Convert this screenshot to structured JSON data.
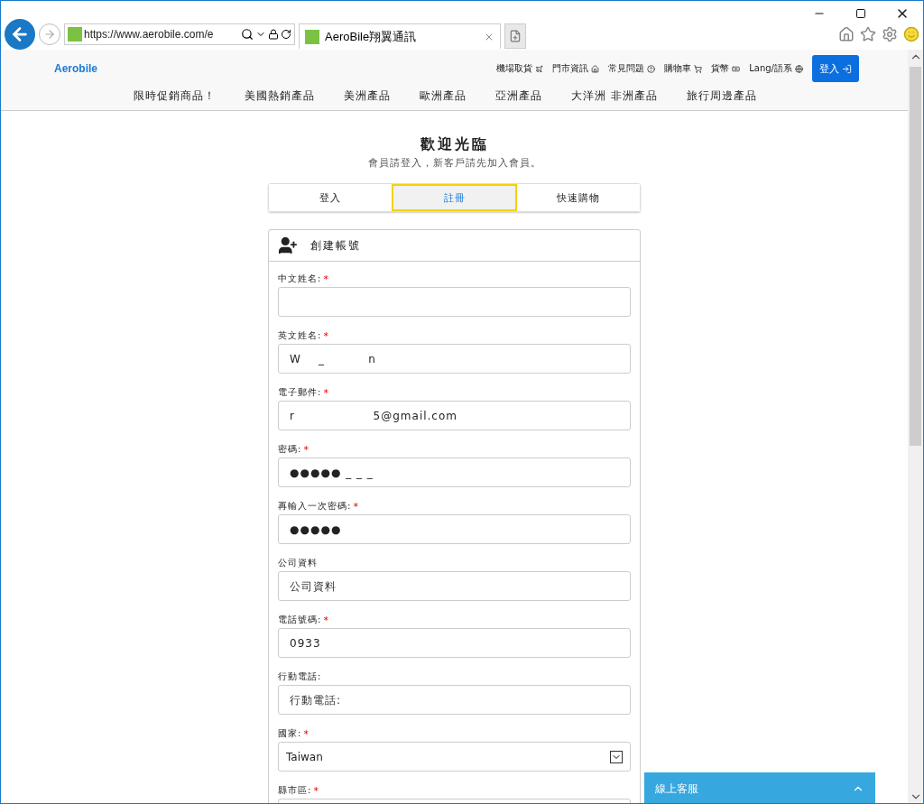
{
  "browser": {
    "url": "https://www.aerobile.com/e",
    "tab_title": "AeroBile翔翼通訊"
  },
  "site": {
    "logo": "Aerobile",
    "top_links": [
      {
        "label": "機場取貨"
      },
      {
        "label": "門市資訊"
      },
      {
        "label": "常見問題"
      },
      {
        "label": "購物車"
      },
      {
        "label": "貨幣"
      },
      {
        "label": "Lang/語系"
      }
    ],
    "login_button": "登入",
    "nav": [
      "限時促銷商品！",
      "美國熱銷產品",
      "美洲產品",
      "歐洲產品",
      "亞洲產品",
      "大洋洲 非洲產品",
      "旅行周邊產品"
    ]
  },
  "heading": {
    "title": "歡迎光臨",
    "subtitle": "會員請登入，新客戶請先加入會員。"
  },
  "tabs": [
    {
      "label": "登入",
      "selected": false
    },
    {
      "label": "註冊",
      "selected": true
    },
    {
      "label": "快速購物",
      "selected": false
    }
  ],
  "form": {
    "title": "創建帳號",
    "fields": [
      {
        "kind": "text",
        "label": "中文姓名:",
        "required_mark": "*"
      },
      {
        "kind": "text",
        "label": "英文姓名:",
        "required_mark": "*",
        "value": "W    _          n"
      },
      {
        "kind": "text",
        "label": "電子郵件:",
        "required_mark": "*",
        "value": "r                  5@gmail.com"
      },
      {
        "kind": "text",
        "label": "密碼:",
        "required_mark": "*",
        "value": "●●●●● _ _ _"
      },
      {
        "kind": "text",
        "label": "再輸入一次密碼:",
        "required_mark": "*",
        "value": "●●●●●"
      },
      {
        "kind": "text",
        "label": "公司資料",
        "placeholder": "公司資料"
      },
      {
        "kind": "text",
        "label": "電話號碼:",
        "required_mark": "*",
        "value": "0933"
      },
      {
        "kind": "text",
        "label": "行動電話:",
        "placeholder": "行動電話:"
      },
      {
        "kind": "select",
        "label": "國家:",
        "required_mark": "*",
        "value": "Taiwan"
      },
      {
        "kind": "text",
        "label": "縣市區:",
        "required_mark": "*"
      }
    ]
  },
  "chat": {
    "label": "線上客服"
  }
}
